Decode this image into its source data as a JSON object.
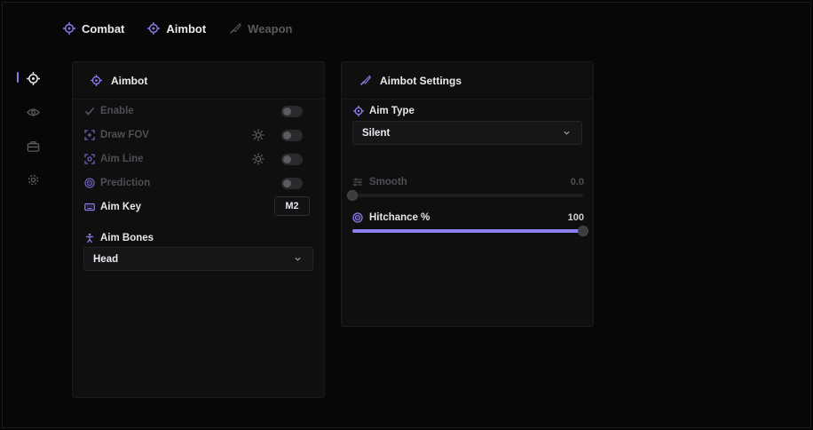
{
  "tabs": [
    {
      "label": "Combat",
      "icon": "crosshair-icon",
      "active": true
    },
    {
      "label": "Aimbot",
      "icon": "crosshair-icon",
      "active": true
    },
    {
      "label": "Weapon",
      "icon": "knife-icon",
      "active": false
    }
  ],
  "rail": [
    "crosshair-icon",
    "eye-icon",
    "toolbox-icon",
    "gear-icon"
  ],
  "left_panel": {
    "title": "Aimbot",
    "rows": {
      "enable": "Enable",
      "draw_fov": "Draw FOV",
      "aim_line": "Aim Line",
      "prediction": "Prediction",
      "aim_key": "Aim Key",
      "aim_key_value": "M2"
    },
    "bones_label": "Aim Bones",
    "bones_value": "Head"
  },
  "right_panel": {
    "title": "Aimbot Settings",
    "aim_type_label": "Aim Type",
    "aim_type_value": "Silent",
    "smooth": {
      "label": "Smooth",
      "value_text": "0.0",
      "value": 0.0,
      "min": 0,
      "max": 100
    },
    "hitchance": {
      "label": "Hitchance %",
      "value_text": "100",
      "value": 100,
      "min": 0,
      "max": 100
    }
  },
  "colors": {
    "accent": "#8c7ff0",
    "background": "#070707",
    "panel": "#0f0f10",
    "muted": "#4e4e54"
  }
}
